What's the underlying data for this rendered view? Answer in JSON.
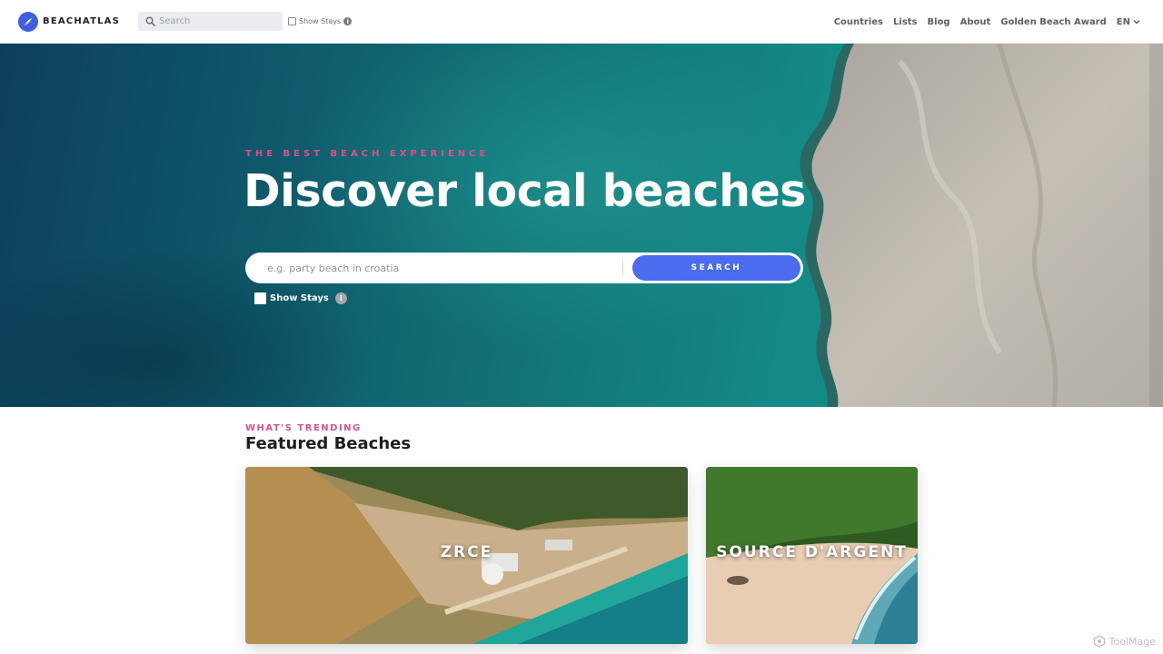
{
  "navbar": {
    "brand": "BEACHATLAS",
    "search_placeholder": "Search",
    "show_stays_label": "Show Stays",
    "links": [
      "Countries",
      "Lists",
      "Blog",
      "About",
      "Golden Beach Award"
    ],
    "language": "EN"
  },
  "hero": {
    "kicker": "THE BEST BEACH EXPERIENCE",
    "title": "Discover local beaches",
    "search_placeholder": "e.g. party beach in croatia",
    "search_button": "SEARCH",
    "show_stays_label": "Show Stays"
  },
  "featured": {
    "kicker": "WHAT'S TRENDING",
    "title": "Featured Beaches",
    "cards": [
      {
        "label": "ZRCE"
      },
      {
        "label": "SOURCE D'ARGENT"
      }
    ]
  },
  "watermark": "ToolMage",
  "colors": {
    "accent": "#4c6cf0",
    "kicker_pink": "#e24d8c",
    "brand_blue": "#3f5fe0"
  },
  "icons": [
    "compass-logo-icon",
    "search-icon",
    "info-icon",
    "chevron-down-icon",
    "watermark-logo-icon"
  ]
}
